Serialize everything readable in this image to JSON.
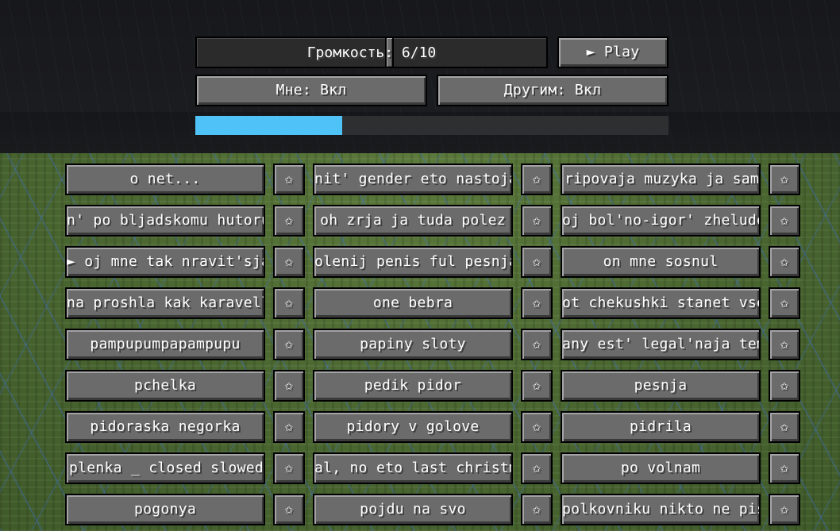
{
  "controls": {
    "volume_label": "Громкость: 6/10",
    "volume_value": 6,
    "volume_max": 10,
    "play_label": "► Play",
    "me_label": "Мне: Вкл",
    "others_label": "Другим: Вкл",
    "progress_fraction": 0.31
  },
  "songs": [
    [
      "o net...",
      "nit' gender eto nastojas",
      "ripovaja muzyka ja sam"
    ],
    [
      "n' po bljadskomu hutoru",
      "oh zrja ja tuda polez",
      "oj bol'no-igor' zheludok"
    ],
    [
      "► oj mne tak nravit'sja",
      "olenij penis ful pesnja",
      "on mne sosnul"
    ],
    [
      "na proshla kak karavella",
      "one bebra",
      "ot chekushki stanet vsen"
    ],
    [
      "pampupumpapampupu",
      "papiny sloty",
      "any est' legal'naja temka"
    ],
    [
      "pchelka",
      "pedik pidor",
      "pesnja"
    ],
    [
      "pidoraska negorka",
      "pidory v golove",
      "pidrila"
    ],
    [
      "plenka _ closed slowed",
      "al, no eto last christmas",
      "po volnam"
    ],
    [
      "pogonya",
      "pojdu na svo",
      "polkovniku nikto ne pishe"
    ]
  ],
  "favorite_symbol": "✩",
  "colors": {
    "progress_fill": "#4fc3f7",
    "button_face": "#6b6b6b",
    "topbar_bg": "#1b1c20"
  }
}
